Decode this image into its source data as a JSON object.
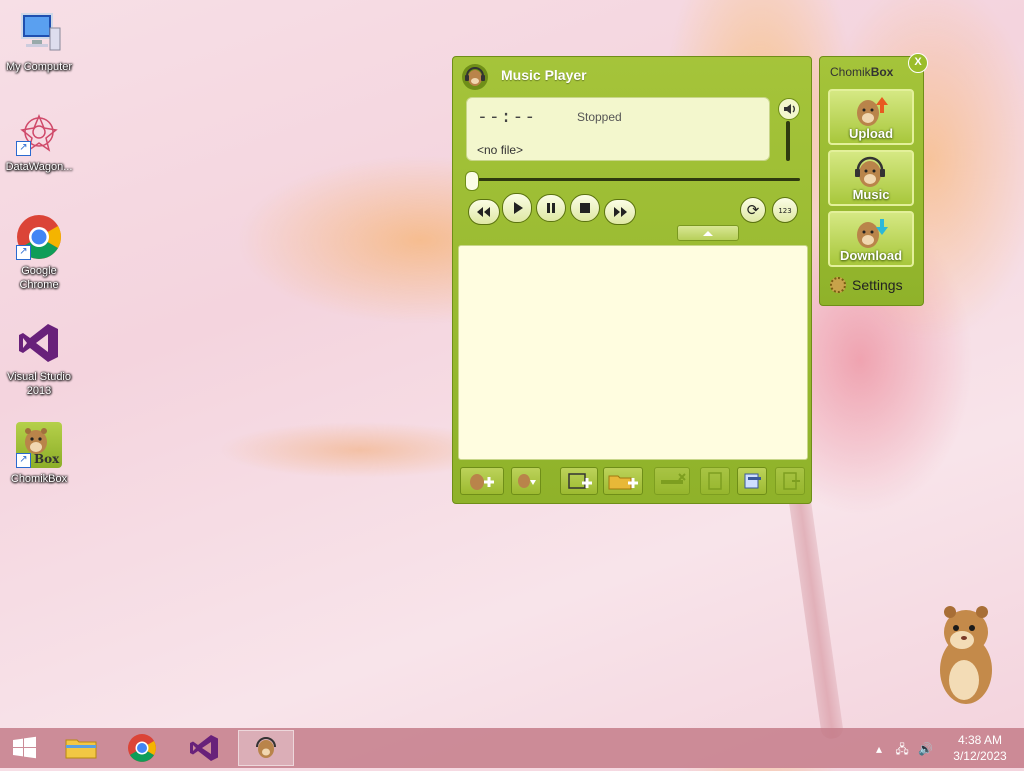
{
  "desktop": {
    "icons": [
      {
        "label": "My Computer"
      },
      {
        "label": "DataWagon..."
      },
      {
        "label": "Google Chrome"
      },
      {
        "label": "Visual Studio 2013"
      },
      {
        "label": "ChomikBox",
        "badge": "Box"
      }
    ]
  },
  "music_player": {
    "title": "Music Player",
    "time": "--:--",
    "status": "Stopped",
    "file": "<no file>",
    "seek_progress": 0,
    "controls": [
      "rewind-icon",
      "play-icon",
      "pause-icon",
      "stop-icon",
      "fast-forward-icon"
    ],
    "extra_controls": [
      "repeat-icon",
      "shuffle-icon"
    ],
    "repeat_glyph": "⟳",
    "shuffle_glyph": "123",
    "toolbar": [
      "add-file-icon",
      "add-playlist-icon",
      "add-folder-icon",
      "add-directory-icon",
      "remove-icon",
      "new-playlist-icon",
      "save-playlist-icon",
      "export-icon"
    ]
  },
  "chomikbox": {
    "title_prefix": "Chomik",
    "title_bold": "Box",
    "close_label": "X",
    "buttons": [
      {
        "label": "Upload"
      },
      {
        "label": "Music"
      },
      {
        "label": "Download"
      }
    ],
    "settings_label": "Settings"
  },
  "taskbar": {
    "apps": [
      "file-explorer-icon",
      "chrome-icon",
      "visual-studio-icon",
      "chomikbox-icon"
    ],
    "clock": {
      "time": "4:38 AM",
      "date": "3/12/2023"
    }
  },
  "colors": {
    "panel_green": "#9bbd2b",
    "lcd_bg": "#f3f7cd",
    "playlist_bg": "#fffde0",
    "taskbar": "#c47c8a"
  }
}
